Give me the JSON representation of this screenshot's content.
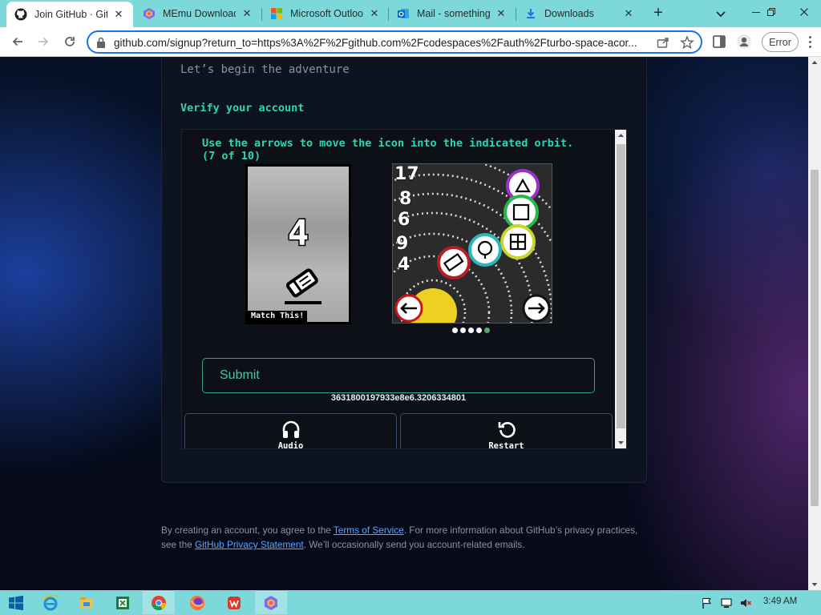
{
  "browser": {
    "tabs": [
      {
        "title": "Join GitHub · GitHub",
        "active": true,
        "icon": "github-icon"
      },
      {
        "title": "MEmu Download",
        "active": false,
        "icon": "memu-icon"
      },
      {
        "title": "Microsoft Outlook",
        "active": false,
        "icon": "microsoft-icon"
      },
      {
        "title": "Mail - something",
        "active": false,
        "icon": "outlook-icon"
      },
      {
        "title": "Downloads",
        "active": false,
        "icon": "download-icon"
      }
    ],
    "url": "github.com/signup?return_to=https%3A%2F%2Fgithub.com%2Fcodespaces%2Fauth%2Fturbo-space-acor...",
    "error_label": "Error"
  },
  "page": {
    "tagline": "Let’s begin the adventure",
    "verify_title": "Verify your account",
    "captcha": {
      "instructions": "Use the arrows to move the icon into the indicated orbit. (7 of 10)",
      "match_number": "4",
      "match_label": "Match This!",
      "orbit_numbers": [
        "17",
        "8",
        "6",
        "9",
        "4"
      ],
      "carousel_total": 5,
      "carousel_active": 5,
      "submit_label": "Submit",
      "token": "3631800197933e8e6.3206334801",
      "audio_label": "Audio",
      "restart_label": "Restart"
    },
    "legal": {
      "prefix": "By creating an account, you agree to the ",
      "terms_link": "Terms of Service",
      "middle": ". For more information about GitHub’s privacy practices, see the ",
      "privacy_link": "GitHub Privacy Statement",
      "suffix": ". We’ll occasionally send you account-related emails."
    }
  },
  "taskbar": {
    "apps": [
      "ie-icon",
      "file-explorer-icon",
      "excel-icon",
      "chrome-icon",
      "firefox-icon",
      "wps-icon",
      "memu-icon"
    ],
    "clock": "3:49 AM"
  },
  "colors": {
    "accent_teal": "#2fd4b4",
    "link_blue": "#58a6ff",
    "tabstrip": "#7dd8da"
  }
}
